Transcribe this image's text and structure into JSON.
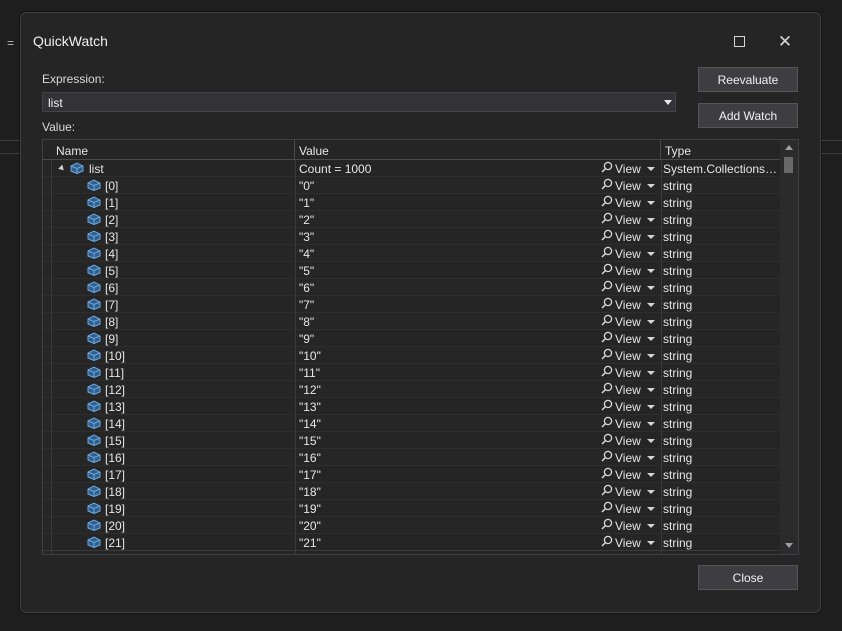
{
  "background": {
    "eq_glyph": "="
  },
  "dialog": {
    "title": "QuickWatch",
    "maximize_icon": "maximize-icon",
    "close_icon": "close-icon"
  },
  "expression": {
    "label": "Expression:",
    "value": "list"
  },
  "value_label": "Value:",
  "buttons": {
    "reevaluate": "Reevaluate",
    "add_watch": "Add Watch",
    "close": "Close"
  },
  "grid": {
    "headers": {
      "name": "Name",
      "value": "Value",
      "type": "Type"
    },
    "view_label": "View",
    "root": {
      "name": "list",
      "value": "Count = 1000",
      "type": "System.Collections.Generic.List<string>"
    },
    "items": [
      {
        "name": "[0]",
        "value": "\"0\"",
        "type": "string"
      },
      {
        "name": "[1]",
        "value": "\"1\"",
        "type": "string"
      },
      {
        "name": "[2]",
        "value": "\"2\"",
        "type": "string"
      },
      {
        "name": "[3]",
        "value": "\"3\"",
        "type": "string"
      },
      {
        "name": "[4]",
        "value": "\"4\"",
        "type": "string"
      },
      {
        "name": "[5]",
        "value": "\"5\"",
        "type": "string"
      },
      {
        "name": "[6]",
        "value": "\"6\"",
        "type": "string"
      },
      {
        "name": "[7]",
        "value": "\"7\"",
        "type": "string"
      },
      {
        "name": "[8]",
        "value": "\"8\"",
        "type": "string"
      },
      {
        "name": "[9]",
        "value": "\"9\"",
        "type": "string"
      },
      {
        "name": "[10]",
        "value": "\"10\"",
        "type": "string"
      },
      {
        "name": "[11]",
        "value": "\"11\"",
        "type": "string"
      },
      {
        "name": "[12]",
        "value": "\"12\"",
        "type": "string"
      },
      {
        "name": "[13]",
        "value": "\"13\"",
        "type": "string"
      },
      {
        "name": "[14]",
        "value": "\"14\"",
        "type": "string"
      },
      {
        "name": "[15]",
        "value": "\"15\"",
        "type": "string"
      },
      {
        "name": "[16]",
        "value": "\"16\"",
        "type": "string"
      },
      {
        "name": "[17]",
        "value": "\"17\"",
        "type": "string"
      },
      {
        "name": "[18]",
        "value": "\"18\"",
        "type": "string"
      },
      {
        "name": "[19]",
        "value": "\"19\"",
        "type": "string"
      },
      {
        "name": "[20]",
        "value": "\"20\"",
        "type": "string"
      },
      {
        "name": "[21]",
        "value": "\"21\"",
        "type": "string"
      }
    ]
  },
  "colors": {
    "accent_icon": "#5a9bd8",
    "dialog_bg": "#252526",
    "button_bg": "#3e3e42"
  }
}
